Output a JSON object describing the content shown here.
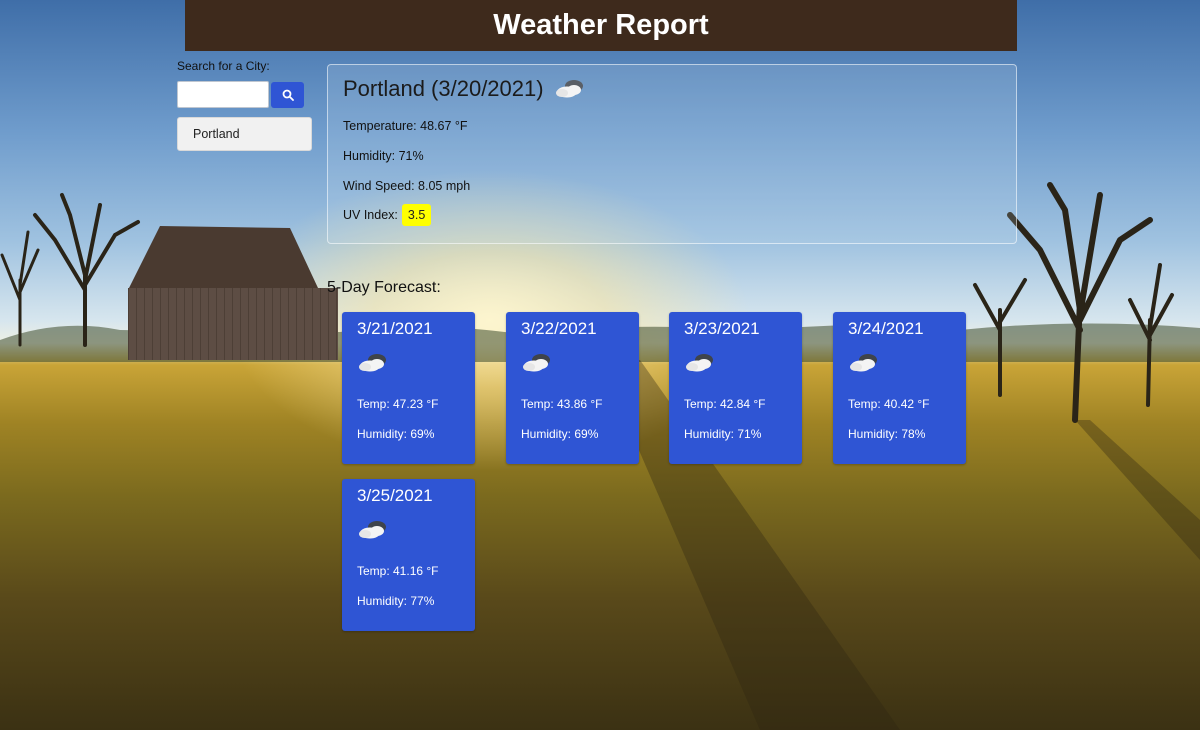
{
  "header": {
    "title": "Weather Report"
  },
  "search": {
    "label": "Search for a City:",
    "value": "",
    "button_icon": "search-icon"
  },
  "history": [
    {
      "city": "Portland"
    }
  ],
  "current": {
    "title": "Portland (3/20/2021)",
    "icon": "partly-cloudy-icon",
    "temperature": "Temperature: 48.67 °F",
    "humidity": "Humidity: 71%",
    "wind": "Wind Speed: 8.05 mph",
    "uv_label": "UV Index:",
    "uv_value": "3.5",
    "uv_color": "#ffff00"
  },
  "forecast": {
    "heading": "5-Day Forecast:",
    "card_color": "#2f55d4",
    "days": [
      {
        "date": "3/21/2021",
        "icon": "partly-cloudy-icon",
        "temp": "Temp: 47.23 °F",
        "humidity": "Humidity: 69%"
      },
      {
        "date": "3/22/2021",
        "icon": "partly-cloudy-icon",
        "temp": "Temp: 43.86 °F",
        "humidity": "Humidity: 69%"
      },
      {
        "date": "3/23/2021",
        "icon": "partly-cloudy-icon",
        "temp": "Temp: 42.84 °F",
        "humidity": "Humidity: 71%"
      },
      {
        "date": "3/24/2021",
        "icon": "partly-cloudy-icon",
        "temp": "Temp: 40.42 °F",
        "humidity": "Humidity: 78%"
      },
      {
        "date": "3/25/2021",
        "icon": "partly-cloudy-icon",
        "temp": "Temp: 41.16 °F",
        "humidity": "Humidity: 77%"
      }
    ]
  }
}
